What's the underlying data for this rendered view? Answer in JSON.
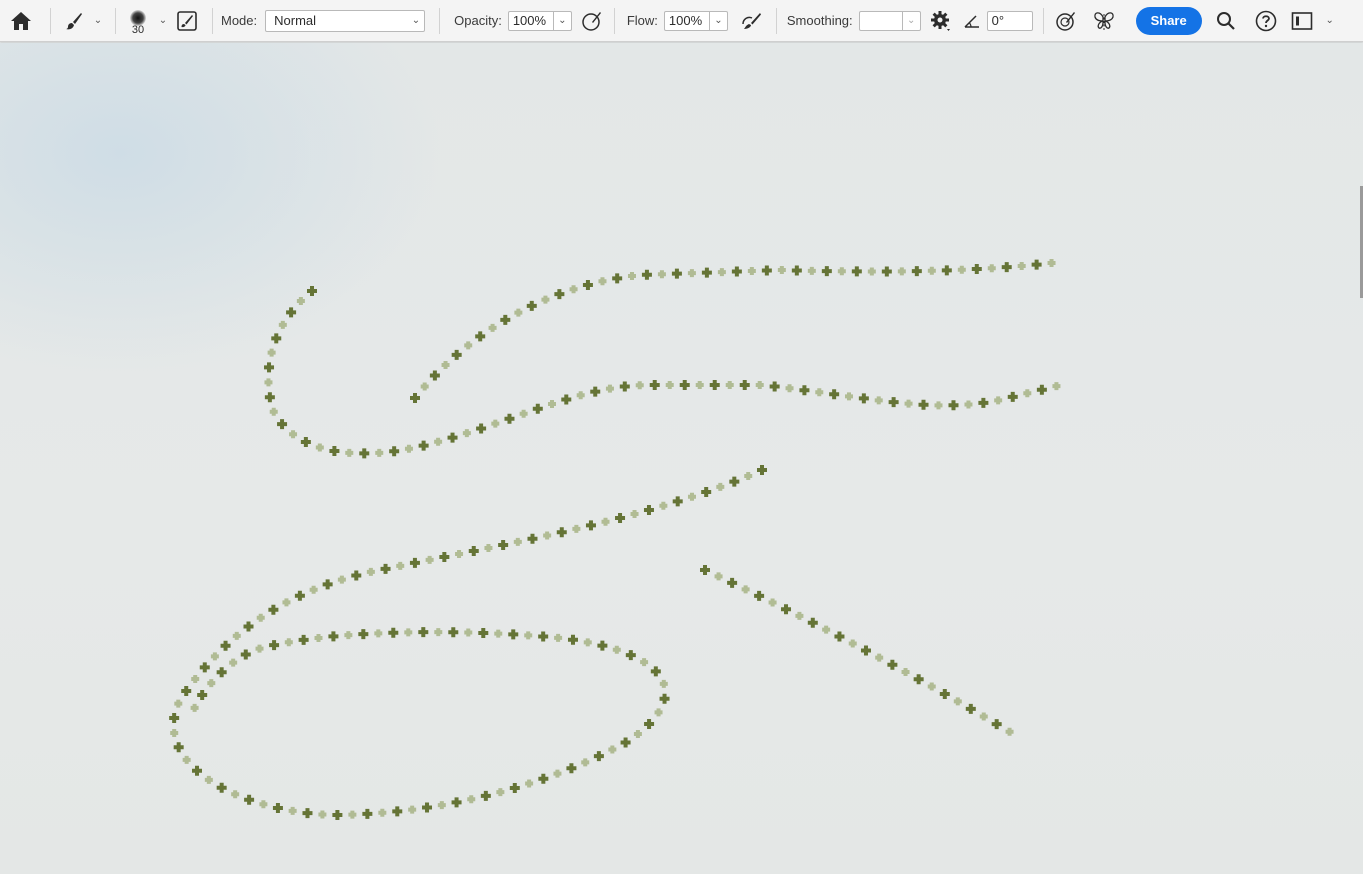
{
  "toolbar": {
    "home_icon": "home-icon",
    "brush_tool_icon": "brush-icon",
    "brush_size": "30",
    "mode_label": "Mode:",
    "mode_value": "Normal",
    "opacity_label": "Opacity:",
    "opacity_value": "100%",
    "flow_label": "Flow:",
    "flow_value": "100%",
    "smoothing_label": "Smoothing:",
    "smoothing_value": "",
    "angle_value": "0°",
    "share_label": "Share"
  },
  "colors": {
    "accent": "#1473e6",
    "stroke_dark": "#5e6e2c",
    "stroke_light": "#9aa870"
  }
}
